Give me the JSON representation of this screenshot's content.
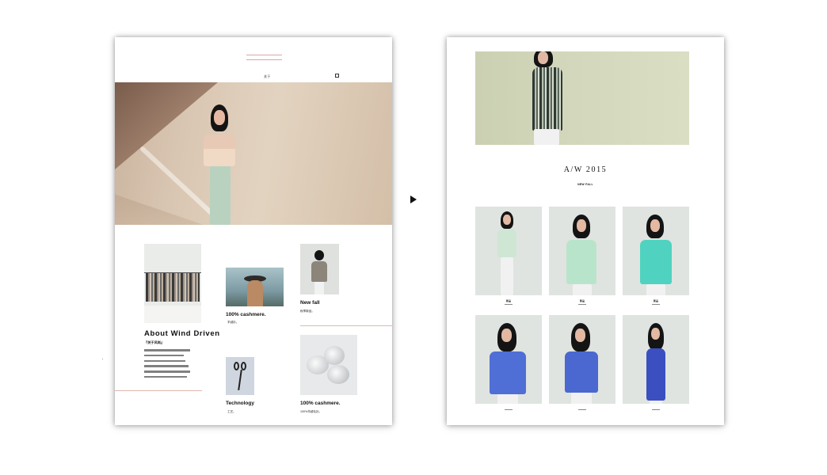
{
  "left_page": {
    "nav": {
      "item_1": "关于",
      "item_2": "",
      "icon": "menu-icon"
    },
    "hero": {
      "image": "model-on-staircase-photo"
    },
    "tiles": {
      "cashmere_top": {
        "caption": "100% cashmere.",
        "sub": "羊绒衫。"
      },
      "new_fall": {
        "caption": "New fall",
        "sub": "秋季新品。"
      },
      "technology": {
        "caption": "Technology",
        "sub": "工艺。"
      },
      "cashmere_bottom": {
        "caption": "100% cashmere.",
        "sub": "100%羊绒毛衫。"
      }
    },
    "about": {
      "title": "About Wind Driven",
      "quote": "『关于风尚』"
    }
  },
  "right_page": {
    "title": "A/W 2015",
    "subtitle": "NEW FALL",
    "products": [
      {
        "label": "新品",
        "sweater_color": "#cfe6d4"
      },
      {
        "label": "新品",
        "sweater_color": "#b9e4cc"
      },
      {
        "label": "新品",
        "sweater_color": "#4fd3c0"
      },
      {
        "label": "",
        "sweater_color": "#4f6fd6"
      },
      {
        "label": "",
        "sweater_color": "#4a68cf"
      },
      {
        "label": "",
        "sweater_color": "#3b4fc0"
      }
    ]
  },
  "colors": {
    "accent_rule": "#e2b7b0",
    "banner_bg": "#d2d7bb",
    "product_bg": "#dfe4e0"
  }
}
